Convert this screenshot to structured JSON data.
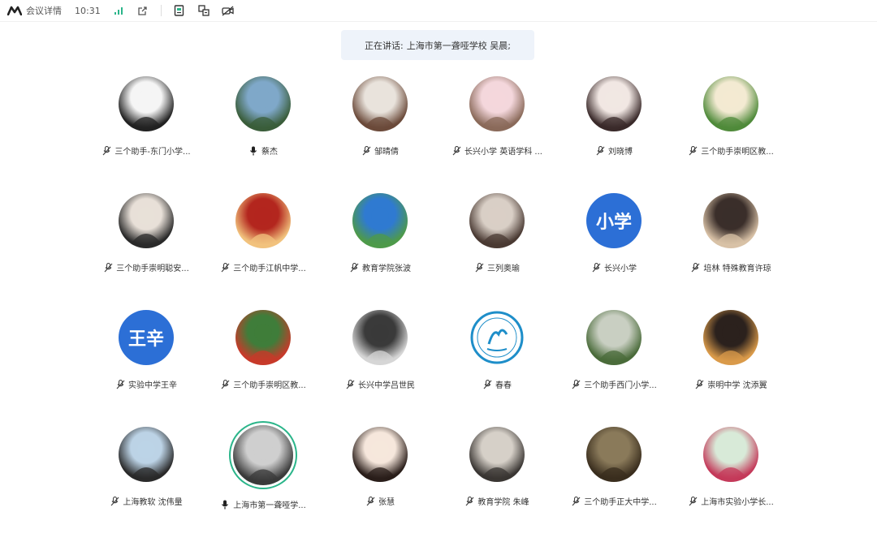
{
  "topbar": {
    "title": "会议详情",
    "time": "10:31",
    "icons": [
      "logo-icon",
      "signal-icon",
      "share-icon",
      "document-icon",
      "translate-icon",
      "hide-video-icon"
    ]
  },
  "speaking_banner": {
    "label": "正在讲话:",
    "speaker": "上海市第一聋哑学校 吴晨;"
  },
  "participants": [
    {
      "name": "三个助手-东门小学...",
      "mic": "muted",
      "avatar": "photo"
    },
    {
      "name": "蔡杰",
      "mic": "on",
      "avatar": "photo"
    },
    {
      "name": "邹晴倩",
      "mic": "muted",
      "avatar": "photo"
    },
    {
      "name": "长兴小学 英语学科 ...",
      "mic": "muted",
      "avatar": "photo"
    },
    {
      "name": "刘晓博",
      "mic": "muted",
      "avatar": "photo"
    },
    {
      "name": "三个助手崇明区教...",
      "mic": "muted",
      "avatar": "photo"
    },
    {
      "name": "三个助手崇明聪安...",
      "mic": "muted",
      "avatar": "photo"
    },
    {
      "name": "三个助手江帆中学...",
      "mic": "muted",
      "avatar": "photo"
    },
    {
      "name": "教育学院张波",
      "mic": "muted",
      "avatar": "photo"
    },
    {
      "name": "三列奥瑜",
      "mic": "muted",
      "avatar": "photo"
    },
    {
      "name": "长兴小学",
      "mic": "muted",
      "avatar": "text",
      "avatar_text": "小学"
    },
    {
      "name": "培林 特殊教育许琼",
      "mic": "muted",
      "avatar": "photo"
    },
    {
      "name": "实验中学王辛",
      "mic": "muted",
      "avatar": "text",
      "avatar_text": "王辛"
    },
    {
      "name": "三个助手崇明区教...",
      "mic": "muted",
      "avatar": "photo"
    },
    {
      "name": "长兴中学吕世民",
      "mic": "muted",
      "avatar": "photo"
    },
    {
      "name": "春春",
      "mic": "muted",
      "avatar": "logo"
    },
    {
      "name": "三个助手西门小学...",
      "mic": "muted",
      "avatar": "photo"
    },
    {
      "name": "崇明中学 沈添翼",
      "mic": "muted",
      "avatar": "photo"
    },
    {
      "name": "上海教软 沈伟量",
      "mic": "muted",
      "avatar": "photo"
    },
    {
      "name": "上海市第一聋哑学...",
      "mic": "on",
      "avatar": "photo",
      "active": true
    },
    {
      "name": "张慧",
      "mic": "muted",
      "avatar": "photo"
    },
    {
      "name": "教育学院 朱峰",
      "mic": "muted",
      "avatar": "photo"
    },
    {
      "name": "三个助手正大中学...",
      "mic": "muted",
      "avatar": "photo"
    },
    {
      "name": "上海市实验小学长...",
      "mic": "muted",
      "avatar": "photo"
    }
  ],
  "colors": {
    "accent_blue": "#2c6fd6",
    "active_ring": "#2bb58a",
    "banner_bg": "#eef3fa"
  }
}
